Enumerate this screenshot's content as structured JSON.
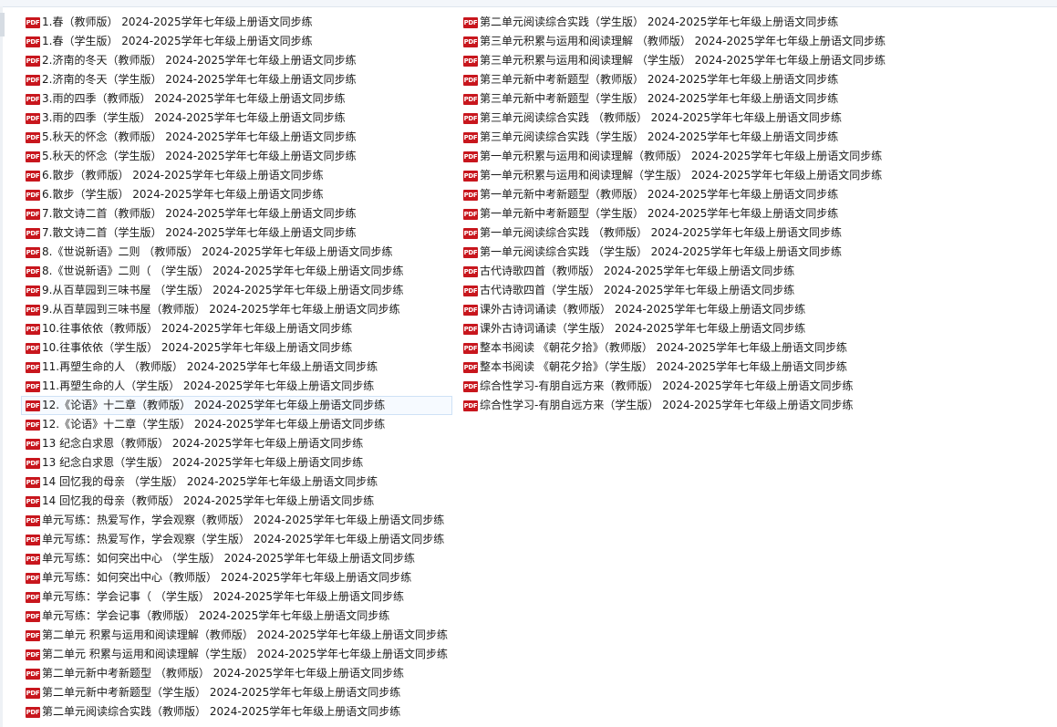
{
  "icon": {
    "name": "pdf-file-icon",
    "glyph": "PDF",
    "color": "#c8161d"
  },
  "colors": {
    "text": "#1a1a1a",
    "selection_border": "#cfe2f6",
    "selection_bg": "#f6faff"
  },
  "selected_index": 20,
  "files_left": [
    "1.春（教师版） 2024-2025学年七年级上册语文同步练",
    "1.春（学生版） 2024-2025学年七年级上册语文同步练",
    "2.济南的冬天（教师版） 2024-2025学年七年级上册语文同步练",
    "2.济南的冬天（学生版） 2024-2025学年七年级上册语文同步练",
    "3.雨的四季（教师版） 2024-2025学年七年级上册语文同步练",
    "3.雨的四季（学生版） 2024-2025学年七年级上册语文同步练",
    "5.秋天的怀念（教师版） 2024-2025学年七年级上册语文同步练",
    "5.秋天的怀念（学生版） 2024-2025学年七年级上册语文同步练",
    "6.散步（教师版） 2024-2025学年七年级上册语文同步练",
    "6.散步（学生版） 2024-2025学年七年级上册语文同步练",
    "7.散文诗二首（教师版） 2024-2025学年七年级上册语文同步练",
    "7.散文诗二首（学生版） 2024-2025学年七年级上册语文同步练",
    "8.《世说新语》二则 （教师版） 2024-2025学年七年级上册语文同步练",
    "8.《世说新语》二则（ （学生版） 2024-2025学年七年级上册语文同步练",
    "9.从百草园到三味书屋 （学生版） 2024-2025学年七年级上册语文同步练",
    "9.从百草园到三味书屋（教师版） 2024-2025学年七年级上册语文同步练",
    "10.往事依依（教师版） 2024-2025学年七年级上册语文同步练",
    "10.往事依依（学生版） 2024-2025学年七年级上册语文同步练",
    "11.再塑生命的人 （教师版） 2024-2025学年七年级上册语文同步练",
    "11.再塑生命的人（学生版） 2024-2025学年七年级上册语文同步练",
    "12.《论语》十二章（教师版） 2024-2025学年七年级上册语文同步练",
    "12.《论语》十二章（学生版） 2024-2025学年七年级上册语文同步练",
    "13 纪念白求恩（教师版） 2024-2025学年七年级上册语文同步练",
    "13 纪念白求恩（学生版） 2024-2025学年七年级上册语文同步练",
    "14 回忆我的母亲 （学生版） 2024-2025学年七年级上册语文同步练",
    "14 回忆我的母亲（教师版） 2024-2025学年七年级上册语文同步练",
    "单元写练：热爱写作，学会观察（教师版） 2024-2025学年七年级上册语文同步练",
    "单元写练：热爱写作，学会观察（学生版） 2024-2025学年七年级上册语文同步练",
    "单元写练：如何突出中心 （学生版） 2024-2025学年七年级上册语文同步练",
    "单元写练：如何突出中心（教师版） 2024-2025学年七年级上册语文同步练",
    "单元写练：学会记事（ （学生版） 2024-2025学年七年级上册语文同步练",
    "单元写练：学会记事（教师版） 2024-2025学年七年级上册语文同步练",
    "第二单元 积累与运用和阅读理解（教师版） 2024-2025学年七年级上册语文同步练",
    "第二单元 积累与运用和阅读理解（学生版） 2024-2025学年七年级上册语文同步练",
    "第二单元新中考新题型 （教师版） 2024-2025学年七年级上册语文同步练",
    "第二单元新中考新题型（学生版） 2024-2025学年七年级上册语文同步练",
    "第二单元阅读综合实践（教师版） 2024-2025学年七年级上册语文同步练"
  ],
  "files_right": [
    "第二单元阅读综合实践（学生版） 2024-2025学年七年级上册语文同步练",
    "第三单元积累与运用和阅读理解 （教师版） 2024-2025学年七年级上册语文同步练",
    "第三单元积累与运用和阅读理解 （学生版） 2024-2025学年七年级上册语文同步练",
    "第三单元新中考新题型（教师版） 2024-2025学年七年级上册语文同步练",
    "第三单元新中考新题型（学生版） 2024-2025学年七年级上册语文同步练",
    "第三单元阅读综合实践 （教师版） 2024-2025学年七年级上册语文同步练",
    "第三单元阅读综合实践（学生版） 2024-2025学年七年级上册语文同步练",
    "第一单元积累与运用和阅读理解（教师版） 2024-2025学年七年级上册语文同步练",
    "第一单元积累与运用和阅读理解（学生版） 2024-2025学年七年级上册语文同步练",
    "第一单元新中考新题型（教师版） 2024-2025学年七年级上册语文同步练",
    "第一单元新中考新题型（学生版） 2024-2025学年七年级上册语文同步练",
    "第一单元阅读综合实践 （教师版） 2024-2025学年七年级上册语文同步练",
    "第一单元阅读综合实践 （学生版） 2024-2025学年七年级上册语文同步练",
    "古代诗歌四首（教师版） 2024-2025学年七年级上册语文同步练",
    "古代诗歌四首（学生版） 2024-2025学年七年级上册语文同步练",
    "课外古诗词诵读（教师版） 2024-2025学年七年级上册语文同步练",
    "课外古诗词诵读（学生版） 2024-2025学年七年级上册语文同步练",
    "整本书阅读 《朝花夕拾》（教师版） 2024-2025学年七年级上册语文同步练",
    "整本书阅读 《朝花夕拾》（学生版） 2024-2025学年七年级上册语文同步练",
    "综合性学习-有朋自远方来（教师版） 2024-2025学年七年级上册语文同步练",
    "综合性学习-有朋自远方来（学生版） 2024-2025学年七年级上册语文同步练"
  ]
}
